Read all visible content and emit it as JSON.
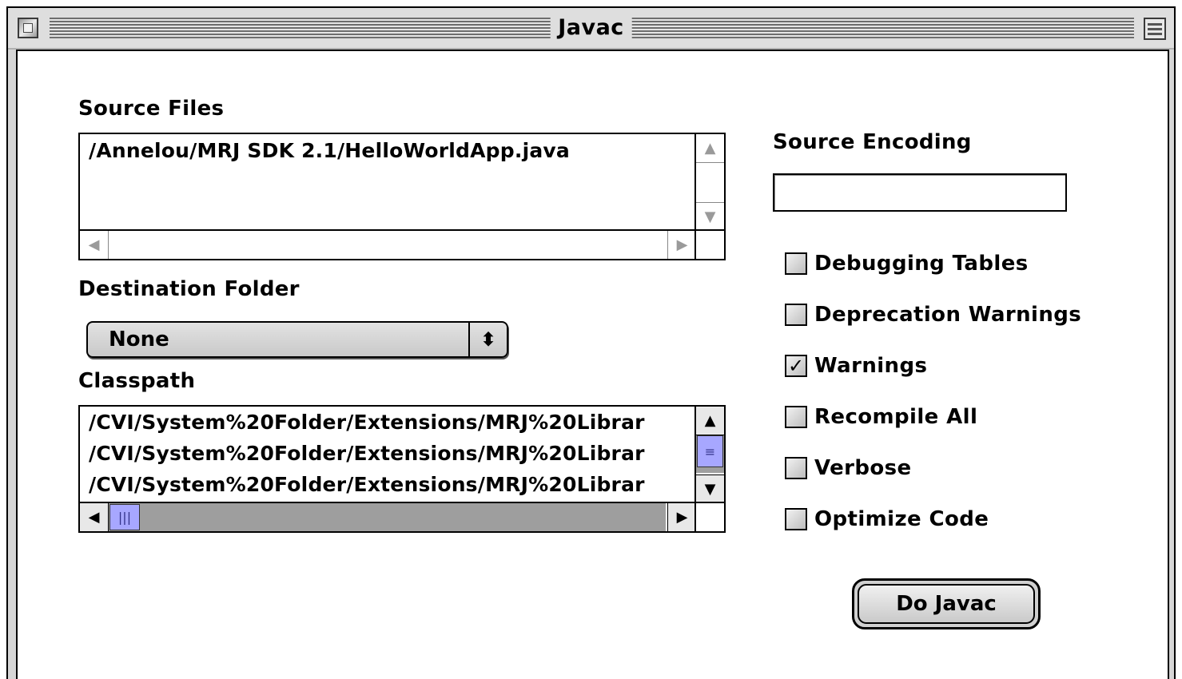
{
  "window": {
    "title": "Javac"
  },
  "source_files": {
    "label": "Source Files",
    "items": [
      "/Annelou/MRJ SDK 2.1/HelloWorldApp.java"
    ]
  },
  "destination_folder": {
    "label": "Destination Folder",
    "selected": "None"
  },
  "classpath": {
    "label": "Classpath",
    "items": [
      "/CVI/System%20Folder/Extensions/MRJ%20Librar",
      "/CVI/System%20Folder/Extensions/MRJ%20Librar",
      "/CVI/System%20Folder/Extensions/MRJ%20Librar"
    ]
  },
  "source_encoding": {
    "label": "Source Encoding",
    "value": ""
  },
  "options": [
    {
      "label": "Debugging Tables",
      "checked": false
    },
    {
      "label": "Deprecation Warnings",
      "checked": false
    },
    {
      "label": "Warnings",
      "checked": true
    },
    {
      "label": "Recompile All",
      "checked": false
    },
    {
      "label": "Verbose",
      "checked": false
    },
    {
      "label": "Optimize Code",
      "checked": false
    }
  ],
  "action_button": {
    "label": "Do Javac"
  },
  "icons": {
    "scroll_up": "▲",
    "scroll_down": "▼",
    "scroll_left": "◀",
    "scroll_right": "▶",
    "popup_arrows": "⬍",
    "check_mark": "✓"
  }
}
